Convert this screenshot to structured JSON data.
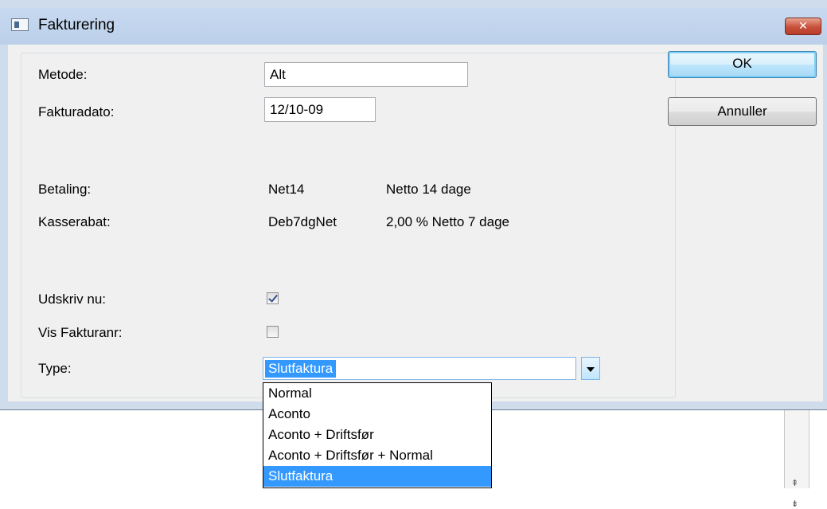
{
  "window": {
    "title": "Fakturering",
    "close_glyph": "✕"
  },
  "buttons": {
    "ok_label": "OK",
    "cancel_label": "Annuller"
  },
  "form": {
    "metode_label": "Metode:",
    "metode_value": "Alt",
    "fakturadato_label": "Fakturadato:",
    "fakturadato_value": "12/10-09",
    "betaling_label": "Betaling:",
    "betaling_code": "Net14",
    "betaling_desc": "Netto 14 dage",
    "kasserabat_label": "Kasserabat:",
    "kasserabat_code": "Deb7dgNet",
    "kasserabat_desc": "2,00 % Netto 7 dage",
    "udskriv_label": "Udskriv nu:",
    "udskriv_checked": true,
    "visfakturanr_label": "Vis Fakturanr:",
    "visfakturanr_checked": false,
    "type_label": "Type:",
    "type_value": "Slutfaktura"
  },
  "type_options": [
    "Normal",
    "Aconto",
    "Aconto + Driftsfør",
    "Aconto + Driftsfør + Normal",
    "Slutfaktura"
  ],
  "type_selected_index": 4,
  "colors": {
    "selection": "#3399ff",
    "titlebar": "#c7d9f0",
    "close_button": "#c9503a"
  }
}
